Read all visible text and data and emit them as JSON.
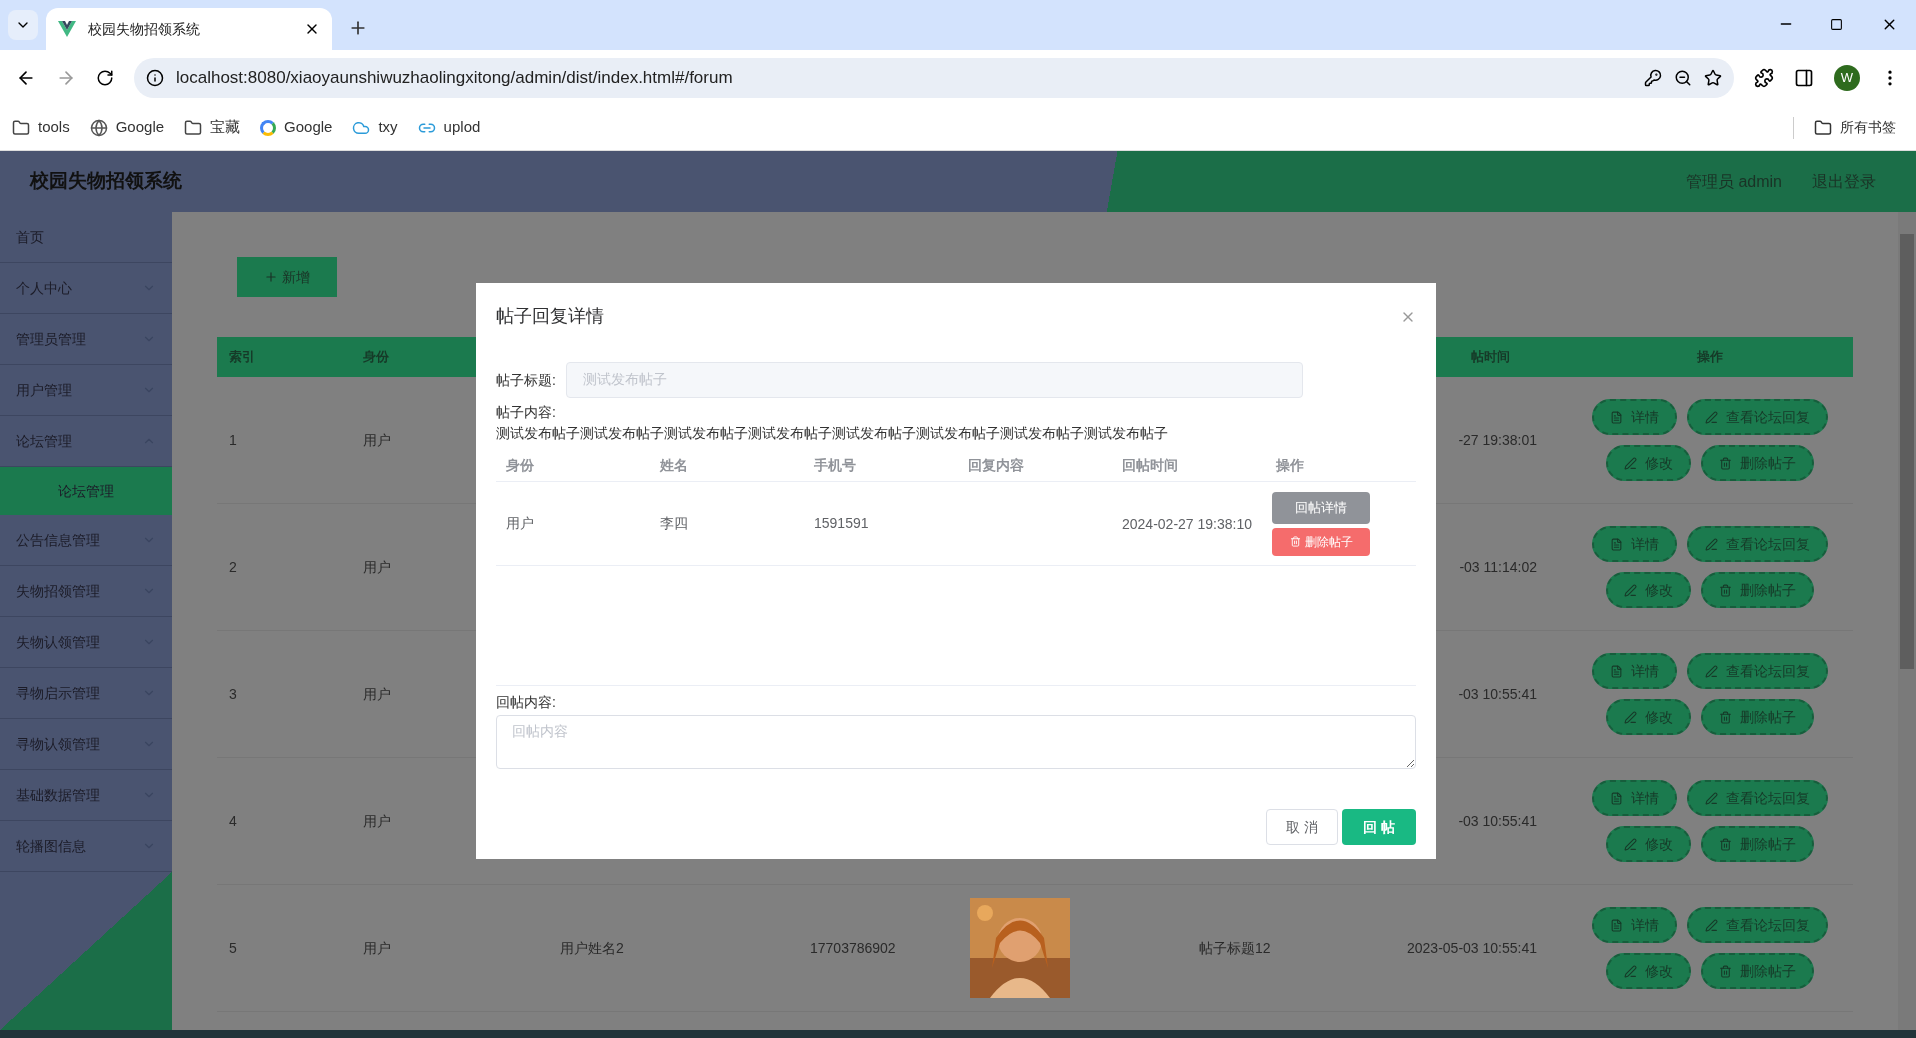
{
  "browser": {
    "tab_title": "校园失物招领系统",
    "url": "localhost:8080/xiaoyaunshiwuzhaolingxitong/admin/dist/index.html#/forum",
    "bookmarks": [
      {
        "label": "tools",
        "kind": "folder"
      },
      {
        "label": "Google",
        "kind": "globe"
      },
      {
        "label": "宝藏",
        "kind": "folder"
      },
      {
        "label": "Google",
        "kind": "google"
      },
      {
        "label": "txy",
        "kind": "cloud"
      },
      {
        "label": "uplod",
        "kind": "link"
      }
    ],
    "all_bookmarks": "所有书签",
    "profile": "W"
  },
  "app": {
    "title": "校园失物招领系统",
    "user": "管理员 admin",
    "logout": "退出登录"
  },
  "sidebar": [
    {
      "label": "首页",
      "kind": "link"
    },
    {
      "label": "个人中心",
      "kind": "menu",
      "expanded": false
    },
    {
      "label": "管理员管理",
      "kind": "menu",
      "expanded": false
    },
    {
      "label": "用户管理",
      "kind": "menu",
      "expanded": false
    },
    {
      "label": "论坛管理",
      "kind": "menu",
      "expanded": true,
      "children": [
        {
          "label": "论坛管理",
          "selected": true
        }
      ]
    },
    {
      "label": "公告信息管理",
      "kind": "menu",
      "expanded": false
    },
    {
      "label": "失物招领管理",
      "kind": "menu",
      "expanded": false
    },
    {
      "label": "失物认领管理",
      "kind": "menu",
      "expanded": false
    },
    {
      "label": "寻物启示管理",
      "kind": "menu",
      "expanded": false
    },
    {
      "label": "寻物认领管理",
      "kind": "menu",
      "expanded": false
    },
    {
      "label": "基础数据管理",
      "kind": "menu",
      "expanded": false
    },
    {
      "label": "轮播图信息",
      "kind": "menu",
      "expanded": false
    }
  ],
  "add_button": "新增",
  "table": {
    "columns": [
      "索引",
      "身份",
      "帖时间",
      "操作"
    ],
    "rows": [
      {
        "index": "1",
        "role": "用户",
        "time": "-27 19:38:01",
        "actions": [
          "详情",
          "查看论坛回复",
          "修改",
          "删除帖子"
        ]
      },
      {
        "index": "2",
        "role": "用户",
        "time": "-03 11:14:02",
        "actions": [
          "详情",
          "查看论坛回复",
          "修改",
          "删除帖子"
        ]
      },
      {
        "index": "3",
        "role": "用户",
        "time": "-03 10:55:41",
        "actions": [
          "详情",
          "查看论坛回复",
          "修改",
          "删除帖子"
        ]
      },
      {
        "index": "4",
        "role": "用户",
        "time": "-03 10:55:41",
        "actions": [
          "详情",
          "查看论坛回复",
          "修改",
          "删除帖子"
        ]
      },
      {
        "index": "5",
        "role": "用户",
        "name": "用户姓名2",
        "phone": "17703786902",
        "photo": {
          "kind": "picture"
        },
        "title": "帖子标题12",
        "time": "2023-05-03 10:55:41",
        "actions": [
          "详情",
          "查看论坛回复",
          "修改",
          "删除帖子"
        ]
      }
    ]
  },
  "modal": {
    "title": "帖子回复详情",
    "title_label": "帖子标题:",
    "title_value": "测试发布帖子",
    "content_label": "帖子内容:",
    "content": "测试发布帖子测试发布帖子测试发布帖子测试发布帖子测试发布帖子测试发布帖子测试发布帖子测试发布帖子",
    "columns": [
      "身份",
      "姓名",
      "手机号",
      "回复内容",
      "回帖时间",
      "操作"
    ],
    "rows": [
      {
        "role": "用户",
        "name": "李四",
        "phone": "1591591",
        "time": "2024-02-27 19:38:10",
        "actions": [
          {
            "label": "回帖详情",
            "kind": "detail"
          },
          {
            "label": "删除帖子",
            "kind": "delete"
          }
        ]
      }
    ],
    "reply_label": "回帖内容:",
    "reply_placeholder": "回帖内容",
    "cancel": "取 消",
    "submit": "回 帖"
  }
}
